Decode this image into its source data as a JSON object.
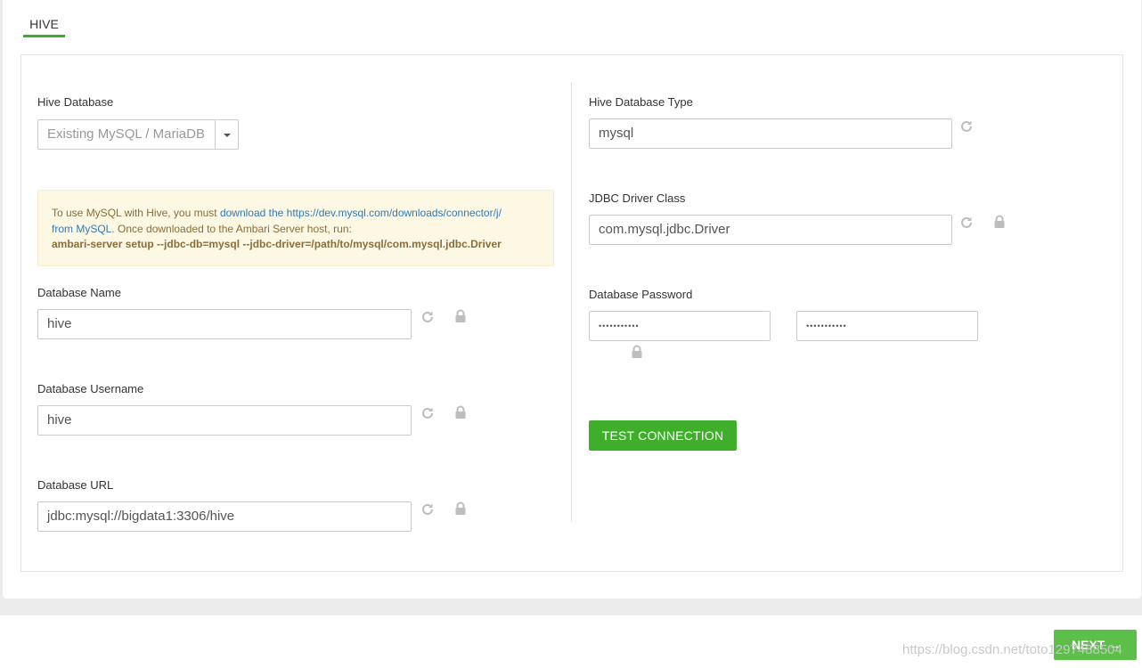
{
  "tab": {
    "label": "HIVE"
  },
  "left": {
    "hive_database": {
      "label": "Hive Database",
      "selected": "Existing MySQL / MariaDB"
    },
    "alert": {
      "text1": "To use MySQL with Hive, you must ",
      "link1": "download the https://dev.mysql.com/downloads/connector/j/",
      "link2": "from MySQL",
      "text2": ". Once downloaded to the Ambari Server host, run:",
      "command": "ambari-server setup --jdbc-db=mysql --jdbc-driver=/path/to/mysql/com.mysql.jdbc.Driver"
    },
    "database_name": {
      "label": "Database Name",
      "value": "hive"
    },
    "database_username": {
      "label": "Database Username",
      "value": "hive"
    },
    "database_url": {
      "label": "Database URL",
      "value": "jdbc:mysql://bigdata1:3306/hive"
    }
  },
  "right": {
    "hive_database_type": {
      "label": "Hive Database Type",
      "value": "mysql"
    },
    "jdbc_driver_class": {
      "label": "JDBC Driver Class",
      "value": "com.mysql.jdbc.Driver"
    },
    "database_password": {
      "label": "Database Password",
      "value": "•••••••••••",
      "confirm_value": "•••••••••••"
    },
    "test_connection_label": "TEST CONNECTION"
  },
  "footer": {
    "next_label": "NEXT →",
    "watermark": "https://blog.csdn.net/toto1297488504"
  },
  "icons": {
    "refresh": "refresh-icon",
    "lock": "lock-icon",
    "caret": "caret-down-icon"
  },
  "colors": {
    "accent": "#3fae2a",
    "link": "#337ab7",
    "alert_bg": "#fcf8e3",
    "alert_text": "#8a6d3b",
    "icon_gray": "#bdbdbd"
  }
}
